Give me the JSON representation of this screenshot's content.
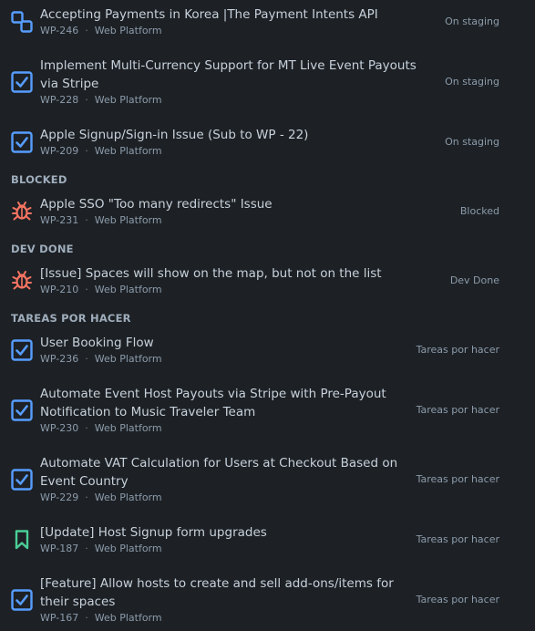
{
  "groups": {
    "blocked": "BLOCKED",
    "dev_done": "DEV DONE",
    "tareas": "TAREAS POR HACER"
  },
  "meta_dot": "·",
  "colors": {
    "background": "#1d2125",
    "task_icon": "#579dff",
    "bug_icon": "#f87462",
    "story_icon": "#4bce97",
    "title_text": "#c7d1db",
    "muted_text": "#8c9bab"
  },
  "items": [
    {
      "icon": "subtask-icon",
      "title": "Accepting Payments in Korea |The Payment Intents API",
      "key": "WP-246",
      "project": "Web Platform",
      "status": "On staging"
    },
    {
      "icon": "task-checkbox-icon",
      "title": "Implement Multi-Currency Support for MT Live Event Payouts via Stripe",
      "key": "WP-228",
      "project": "Web Platform",
      "status": "On staging"
    },
    {
      "icon": "task-checkbox-icon",
      "title": "Apple Signup/Sign-in Issue (Sub to WP - 22)",
      "key": "WP-209",
      "project": "Web Platform",
      "status": "On staging"
    },
    {
      "icon": "bug-icon",
      "title": "Apple SSO \"Too many redirects\" Issue",
      "key": "WP-231",
      "project": "Web Platform",
      "status": "Blocked"
    },
    {
      "icon": "bug-icon",
      "title": "[Issue] Spaces will show on the map, but not on the list",
      "key": "WP-210",
      "project": "Web Platform",
      "status": "Dev Done"
    },
    {
      "icon": "task-checkbox-icon",
      "title": "User Booking Flow",
      "key": "WP-236",
      "project": "Web Platform",
      "status": "Tareas por hacer"
    },
    {
      "icon": "task-checkbox-icon",
      "title": "Automate Event Host Payouts via Stripe with Pre-Payout Notification to Music Traveler Team",
      "key": "WP-230",
      "project": "Web Platform",
      "status": "Tareas por hacer"
    },
    {
      "icon": "task-checkbox-icon",
      "title": "Automate VAT Calculation for Users at Checkout Based on Event Country",
      "key": "WP-229",
      "project": "Web Platform",
      "status": "Tareas por hacer"
    },
    {
      "icon": "story-bookmark-icon",
      "title": "[Update] Host Signup form upgrades",
      "key": "WP-187",
      "project": "Web Platform",
      "status": "Tareas por hacer"
    },
    {
      "icon": "task-checkbox-icon",
      "title": "[Feature] Allow hosts to create and sell add-ons/items for their spaces",
      "key": "WP-167",
      "project": "Web Platform",
      "status": "Tareas por hacer"
    }
  ]
}
